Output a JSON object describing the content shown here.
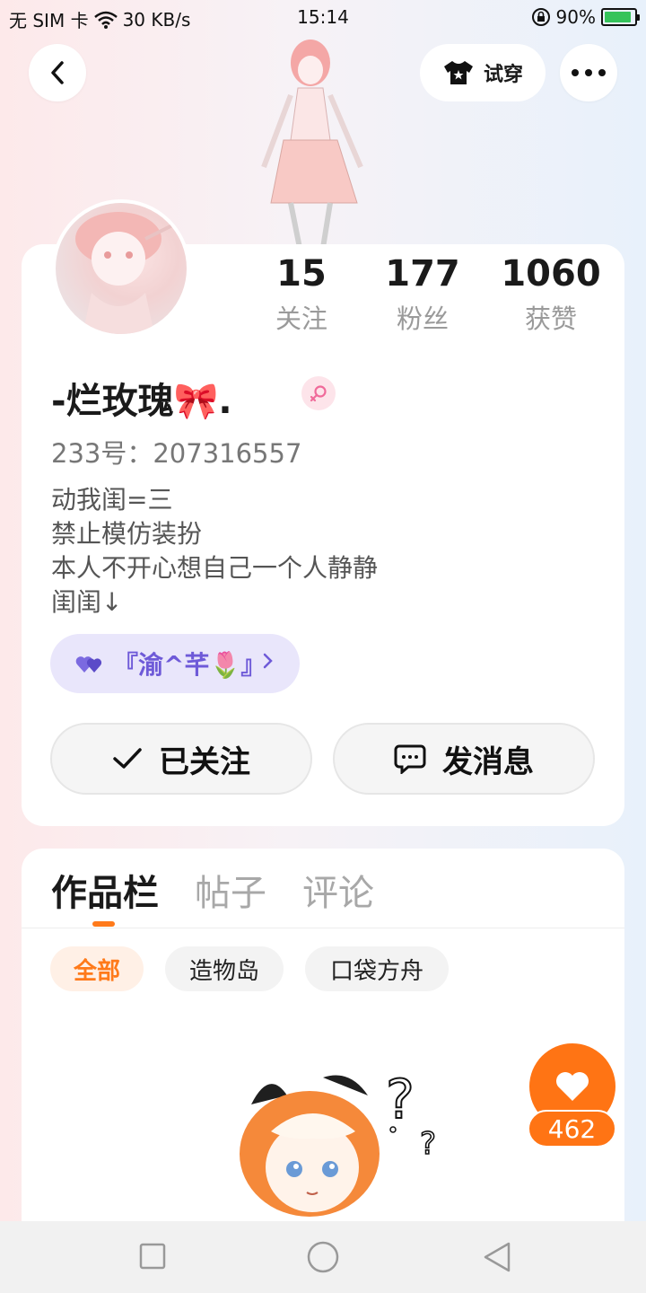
{
  "status_bar": {
    "carrier": "无 SIM 卡",
    "speed": "30 KB/s",
    "time": "15:14",
    "battery": "90%",
    "battery_color": "#35c35a"
  },
  "header": {
    "back_icon": "chevron-left-icon",
    "try_on_label": "试穿",
    "more_icon": "more-dots-icon"
  },
  "profile": {
    "stats": [
      {
        "value": "15",
        "label": "关注"
      },
      {
        "value": "177",
        "label": "粉丝"
      },
      {
        "value": "1060",
        "label": "获赞"
      }
    ],
    "nickname": "-︎︎︎烂玫瑰🎀.",
    "gender_icon": "female-symbol-icon",
    "uid": "233号：207316557",
    "bio_lines": [
      "动我闺=三",
      "禁止模仿装扮",
      "本人不开心想自己一个人静静",
      "闺闺↓"
    ],
    "cp_tag": "『渝^芊🌷』",
    "cp_color": "#6e5ad8",
    "follow_label": "已关注",
    "message_label": "发消息"
  },
  "works": {
    "tabs": [
      "作品栏",
      "帖子",
      "评论"
    ],
    "filters": [
      "全部",
      "造物岛",
      "口袋方舟"
    ],
    "accent": "#ff7a1a",
    "like_count": "462"
  },
  "nav": {
    "icons": [
      "recents-square-icon",
      "home-circle-icon",
      "back-triangle-icon"
    ]
  }
}
